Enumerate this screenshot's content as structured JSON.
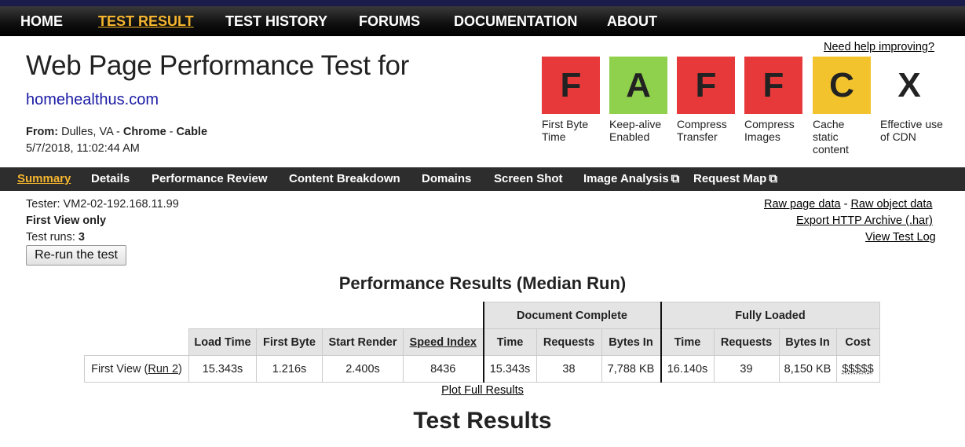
{
  "topnav": {
    "items": [
      "HOME",
      "TEST RESULT",
      "TEST HISTORY",
      "FORUMS",
      "DOCUMENTATION",
      "ABOUT"
    ],
    "active": "TEST RESULT"
  },
  "header": {
    "help_link": "Need help improving?",
    "title": "Web Page Performance Test for",
    "site": "homehealthus.com",
    "from_label": "From:",
    "location": "Dulles, VA",
    "browser": "Chrome",
    "connection": "Cable",
    "sep": " - ",
    "date": "5/7/2018, 11:02:44 AM"
  },
  "grades": [
    {
      "letter": "F",
      "label": "First Byte Time",
      "color": "#e8393a"
    },
    {
      "letter": "A",
      "label": "Keep-alive Enabled",
      "color": "#8fd04d"
    },
    {
      "letter": "F",
      "label": "Compress Transfer",
      "color": "#e8393a"
    },
    {
      "letter": "F",
      "label": "Compress Images",
      "color": "#e8393a"
    },
    {
      "letter": "C",
      "label": "Cache static content",
      "color": "#f2c32c"
    },
    {
      "letter": "X",
      "label": "Effective use of CDN",
      "color": "#ffffff"
    }
  ],
  "subnav": {
    "items": [
      "Summary",
      "Details",
      "Performance Review",
      "Content Breakdown",
      "Domains",
      "Screen Shot",
      "Image Analysis",
      "Request Map"
    ],
    "active": "Summary",
    "external_icon": "⧉"
  },
  "info": {
    "tester": "Tester: VM2-02-192.168.11.99",
    "view": "First View only",
    "runs_label": "Test runs: ",
    "runs": "3",
    "rerun_button": "Re-run the test"
  },
  "links": {
    "raw_page": "Raw page data",
    "dash": " - ",
    "raw_object": "Raw object data",
    "export_har": "Export HTTP Archive (.har)",
    "test_log": "View Test Log"
  },
  "results": {
    "title": "Performance Results (Median Run)",
    "group_doc": "Document Complete",
    "group_full": "Fully Loaded",
    "headers": [
      "Load Time",
      "First Byte",
      "Start Render",
      "Speed Index",
      "Time",
      "Requests",
      "Bytes In",
      "Time",
      "Requests",
      "Bytes In",
      "Cost"
    ],
    "row_label": "First View (",
    "row_link": "Run 2",
    "row_label_end": ")",
    "row": [
      "15.343s",
      "1.216s",
      "2.400s",
      "8436",
      "15.343s",
      "38",
      "7,788 KB",
      "16.140s",
      "39",
      "8,150 KB",
      "$$$$$"
    ],
    "plot_link": "Plot Full Results",
    "section_title": "Test Results"
  }
}
